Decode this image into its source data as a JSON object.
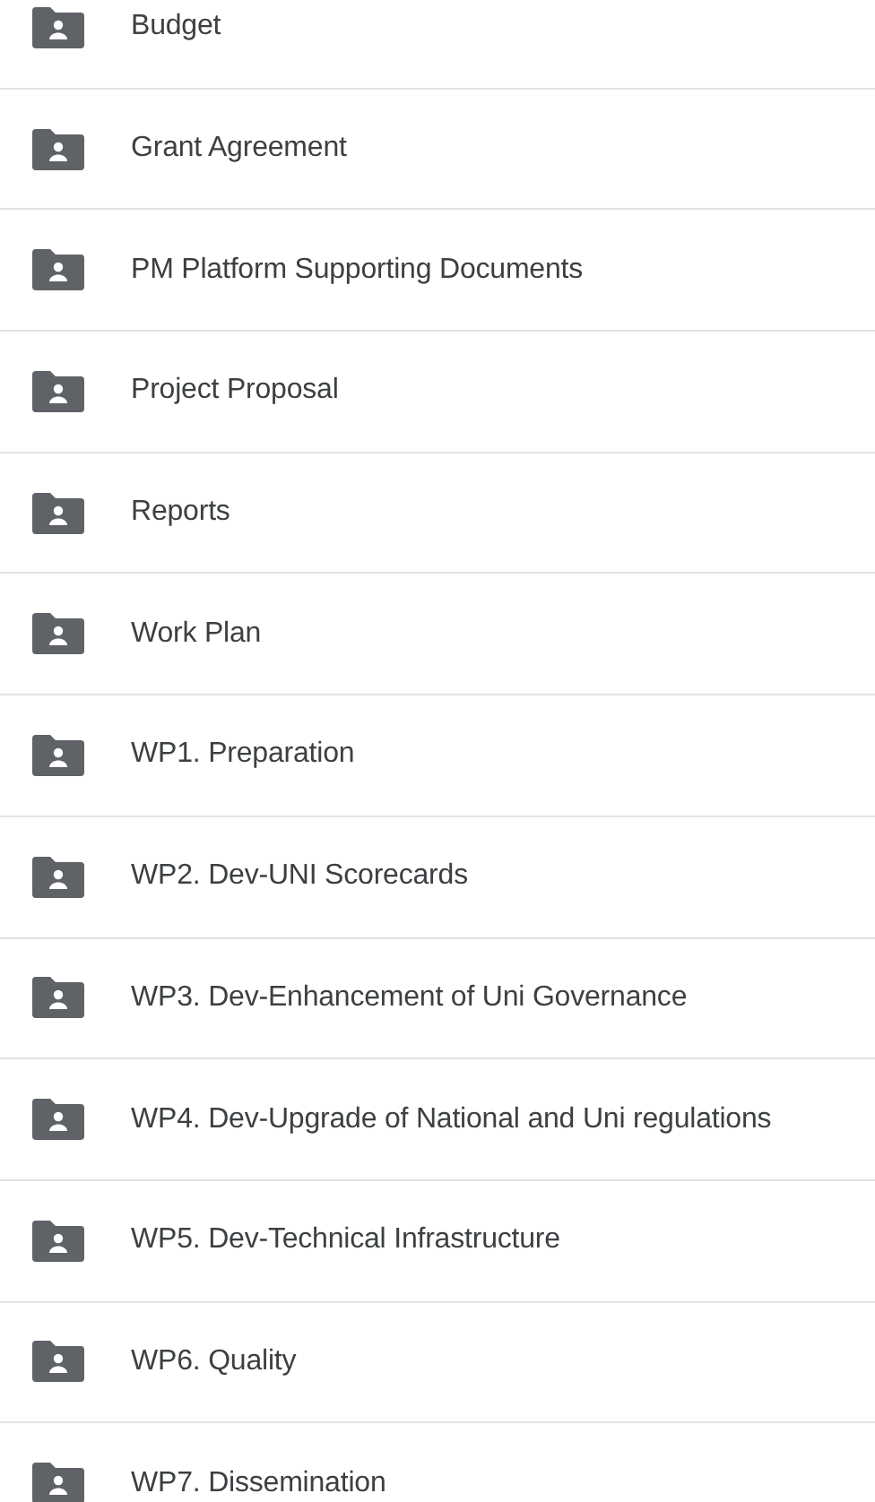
{
  "folders": [
    {
      "name": "Budget"
    },
    {
      "name": "Grant Agreement"
    },
    {
      "name": "PM Platform Supporting Documents"
    },
    {
      "name": "Project Proposal"
    },
    {
      "name": "Reports"
    },
    {
      "name": "Work Plan"
    },
    {
      "name": "WP1. Preparation"
    },
    {
      "name": "WP2. Dev-UNI Scorecards"
    },
    {
      "name": "WP3. Dev-Enhancement of Uni Governance"
    },
    {
      "name": "WP4. Dev-Upgrade of National and Uni regulations"
    },
    {
      "name": "WP5. Dev-Technical Infrastructure"
    },
    {
      "name": "WP6. Quality"
    },
    {
      "name": "WP7. Dissemination"
    }
  ]
}
